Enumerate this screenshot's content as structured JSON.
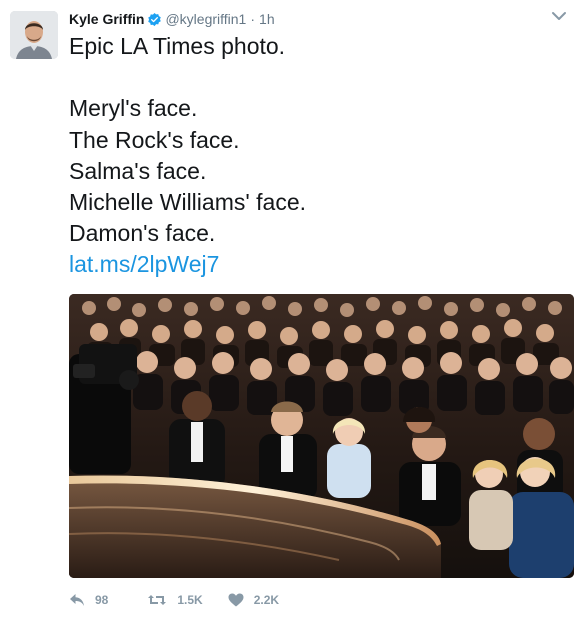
{
  "tweet": {
    "author": {
      "name": "Kyle Griffin",
      "handle": "@kylegriffin1",
      "verified": true
    },
    "separator": "·",
    "time": "1h",
    "lines": [
      "Epic LA Times photo.",
      "Meryl's face.",
      "The Rock's face.",
      "Salma's face.",
      "Michelle Williams' face.",
      "Damon's face."
    ],
    "link": "lat.ms/2lpWej7",
    "stats": {
      "replies": "98",
      "retweets": "1.5K",
      "likes": "2.2K"
    }
  },
  "icons": {
    "verified": "verified-badge-icon",
    "menu": "chevron-down-icon",
    "reply": "reply-icon",
    "retweet": "retweet-icon",
    "like": "heart-icon"
  },
  "colors": {
    "link": "#1b95e0",
    "verified": "#1da1f2",
    "muted": "#657786",
    "action": "#8899a6"
  }
}
